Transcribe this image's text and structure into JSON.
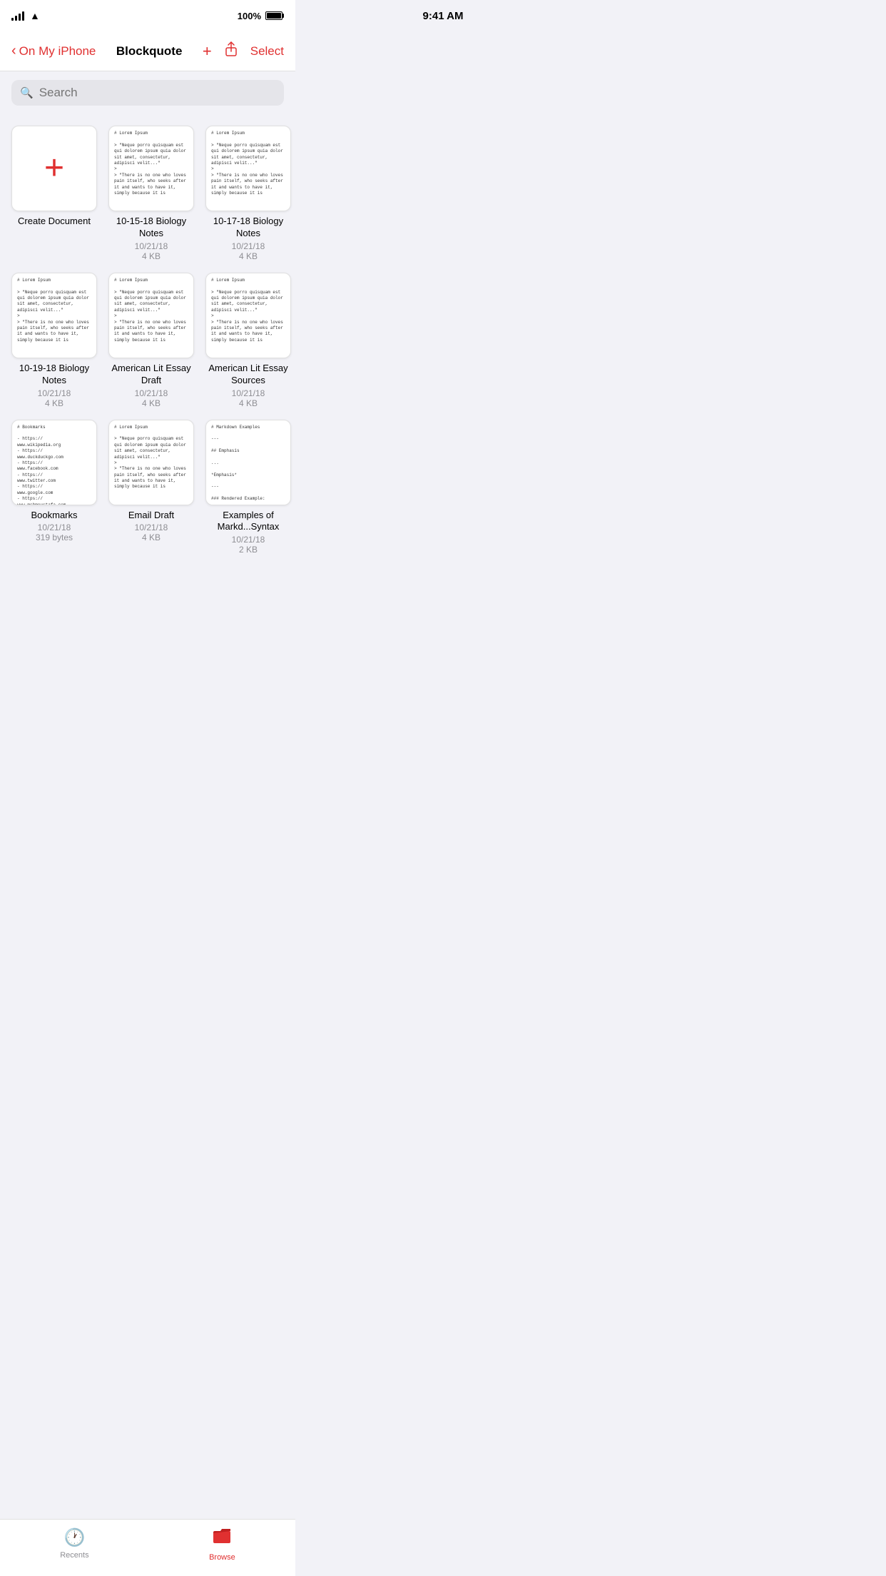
{
  "statusBar": {
    "time": "9:41 AM",
    "batteryPercent": "100%"
  },
  "navBar": {
    "backLabel": "On My iPhone",
    "title": "Blockquote",
    "addIcon": "+",
    "shareIcon": "⬆",
    "selectLabel": "Select"
  },
  "search": {
    "placeholder": "Search"
  },
  "files": [
    {
      "id": "create",
      "type": "create",
      "name": "Create\nDocument",
      "date": "",
      "size": ""
    },
    {
      "id": "bio1",
      "type": "doc",
      "name": "10-15-18\nBiology Notes",
      "date": "10/21/18",
      "size": "4 KB",
      "preview": "# Lorem Ipsum\n\n> \"Neque porro quisquam est qui dolorem ipsum quia dolor sit amet, consectetur, adipisci velit...\"\n>\n> \"There is no one who loves pain itself, who seeks after it and wants to have it, simply because it is"
    },
    {
      "id": "bio2",
      "type": "doc",
      "name": "10-17-18\nBiology Notes",
      "date": "10/21/18",
      "size": "4 KB",
      "preview": "# Lorem Ipsum\n\n> \"Neque porro quisquam est qui dolorem ipsum quia dolor sit amet, consectetur, adipisci velit...\"\n>\n> \"There is no one who loves pain itself, who seeks after it and wants to have it, simply because it is"
    },
    {
      "id": "bio3",
      "type": "doc",
      "name": "10-19-18\nBiology Notes",
      "date": "10/21/18",
      "size": "4 KB",
      "preview": "# Lorem Ipsum\n\n> \"Neque porro quisquam est qui dolorem ipsum quia dolor sit amet, consectetur, adipisci velit...\"\n>\n> \"There is no one who loves pain itself, who seeks after it and wants to have it, simply because it is"
    },
    {
      "id": "amlit1",
      "type": "doc",
      "name": "American Lit\nEssay Draft",
      "date": "10/21/18",
      "size": "4 KB",
      "preview": "# Lorem Ipsum\n\n> \"Neque porro quisquam est qui dolorem ipsum quia dolor sit amet, consectetur, adipisci velit...\"\n>\n> \"There is no one who loves pain itself, who seeks after it and wants to have it, simply because it is"
    },
    {
      "id": "amlit2",
      "type": "doc",
      "name": "American Lit\nEssay Sources",
      "date": "10/21/18",
      "size": "4 KB",
      "preview": "# Lorem Ipsum\n\n> \"Neque porro quisquam est qui dolorem ipsum quia dolor sit amet, consectetur, adipisci velit...\"\n>\n> \"There is no one who loves pain itself, who seeks after it and wants to have it, simply because it is"
    },
    {
      "id": "bookmarks",
      "type": "doc",
      "name": "Bookmarks",
      "date": "10/21/18",
      "size": "319 bytes",
      "preview": "# Bookmarks\n\n- https://\nwww.wikipedia.org\n- https://\nwww.duckduckgo.com\n- https://\nwww.facebook.com\n- https://\nwww.twitter.com\n- https://\nwww.google.com\n- https://\nwww.mshmoustafa.com\n- https://"
    },
    {
      "id": "emaildraft",
      "type": "doc",
      "name": "Email Draft",
      "date": "10/21/18",
      "size": "4 KB",
      "preview": "# Lorem Ipsum\n\n> \"Neque porro quisquam est qui dolorem ipsum quia dolor sit amet, consectetur, adipisci velit...\"\n>\n> \"There is no one who loves pain itself, who seeks after it and wants to have it, simply because it is"
    },
    {
      "id": "markdown",
      "type": "doc",
      "name": "Examples of\nMarkd...Syntax",
      "date": "10/21/18",
      "size": "2 KB",
      "preview": "# Markdown Examples\n\n---\n\n## Emphasis\n\n...\n\n*Emphasis*\n\n---\n\n### Rendered Example:\n\n*Emphasis*\n\n---"
    }
  ],
  "tabBar": {
    "recents": "Recents",
    "browse": "Browse"
  }
}
